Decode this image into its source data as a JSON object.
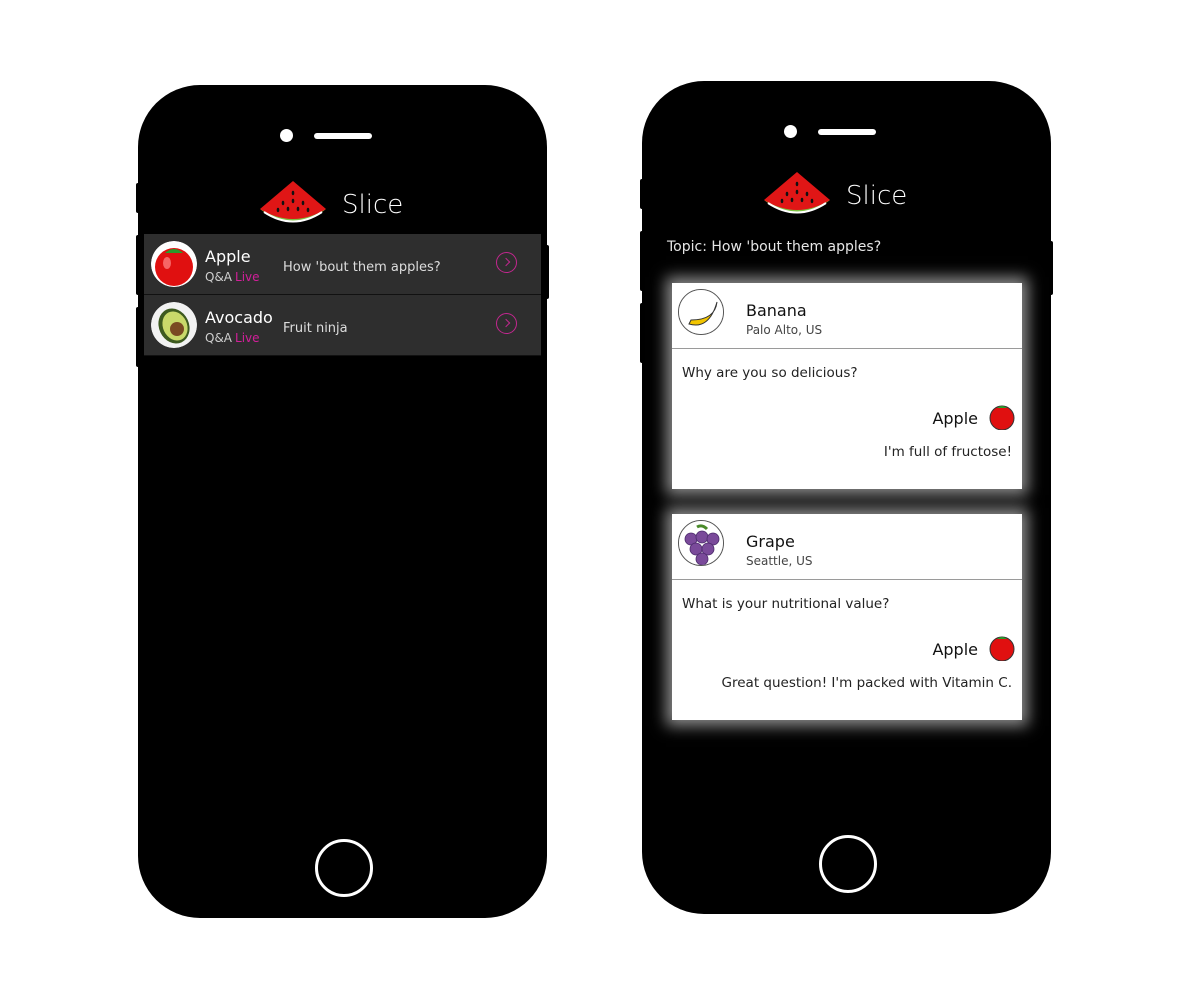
{
  "app": {
    "name": "Slice"
  },
  "left_phone": {
    "rows": [
      {
        "name": "Apple",
        "kind": "Q&A",
        "status": "Live",
        "topic": "How 'bout them apples?",
        "avatar_icon": "apple-icon"
      },
      {
        "name": "Avocado",
        "kind": "Q&A",
        "status": "Live",
        "topic": "Fruit ninja",
        "avatar_icon": "avocado-icon"
      }
    ]
  },
  "right_phone": {
    "topic": "Topic: How 'bout them apples?",
    "cards": [
      {
        "user": "Banana",
        "location": "Palo Alto, US",
        "question": "Why are you so delicious?",
        "answerer": "Apple",
        "answer": "I'm full of fructose!",
        "avatar_icon": "banana-icon"
      },
      {
        "user": "Grape",
        "location": "Seattle, US",
        "question": "What is your nutritional value?",
        "answerer": "Apple",
        "answer": "Great question! I'm packed with Vitamin C.",
        "avatar_icon": "grape-icon"
      }
    ]
  },
  "colors": {
    "accent": "#d21f9a",
    "row_bg": "#2e2e2e",
    "phone": "#000000"
  }
}
